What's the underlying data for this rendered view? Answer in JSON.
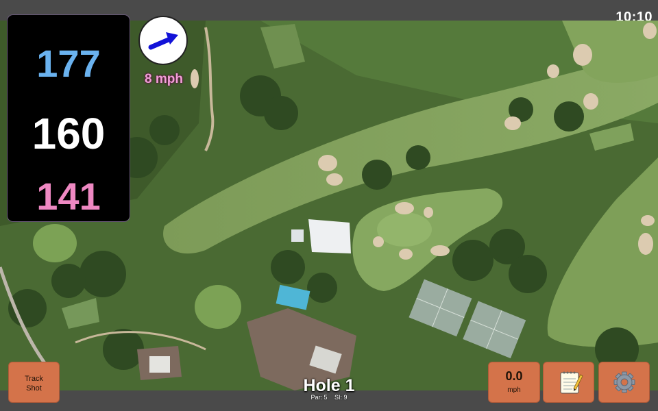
{
  "status": {
    "time": "10:10"
  },
  "distances": {
    "back": "177",
    "middle": "160",
    "front": "141"
  },
  "wind": {
    "speed": "8 mph",
    "icon": "wind-direction-arrow-icon"
  },
  "hole": {
    "title": "Hole 1",
    "par": "Par: 5",
    "si": "SI: 9"
  },
  "buttons": {
    "track_line1": "Track",
    "track_line2": "Shot",
    "speed_value": "0.0",
    "speed_unit": "mph",
    "notes_icon": "notepad-icon",
    "settings_icon": "gear-icon"
  },
  "map": {
    "type": "satellite-golf-course",
    "accent": "#d4734a"
  }
}
